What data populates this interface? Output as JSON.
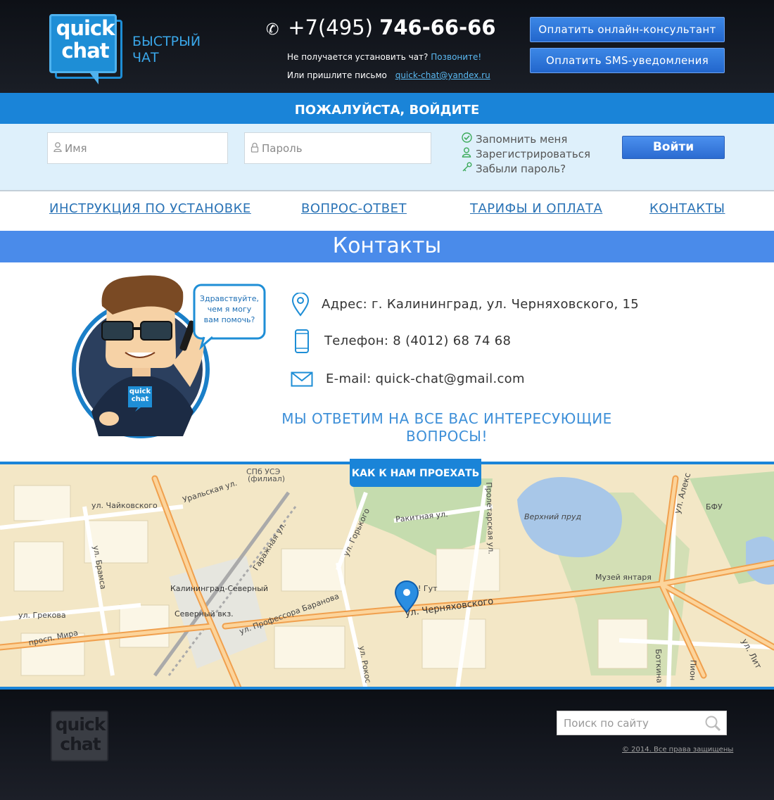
{
  "header": {
    "logo_text": "quick chat",
    "brand_line1": "БЫСТРЫЙ",
    "brand_line2": "ЧАТ",
    "phone_prefix": "+7(495)",
    "phone_number": "746-66-66",
    "line1_text": "Не получается установить чат?",
    "line1_link": "Позвоните!",
    "line2_text": "Или пришлите письмо",
    "line2_email": "quick-chat@yandex.ru",
    "btn_consultant": "Оплатить онлайн-консультант",
    "btn_sms": "Оплатить SMS-уведомления"
  },
  "login": {
    "title": "ПОЖАЛУЙСТА, ВОЙДИТЕ",
    "name_placeholder": "Имя",
    "password_placeholder": "Пароль",
    "remember": "Запомнить меня",
    "register": "Зарегистрироваться",
    "forgot": "Забыли пароль?",
    "submit": "Войти"
  },
  "nav": {
    "install": "ИНСТРУКЦИЯ ПО УСТАНОВКЕ",
    "faq": "ВОПРОС-ОТВЕТ",
    "pricing": "ТАРИФЫ И ОПЛАТА",
    "contacts": "КОНТАКТЫ"
  },
  "page": {
    "title": "Контакты"
  },
  "contacts": {
    "bubble_line1": "Здравствуйте,",
    "bubble_line2": "чем я могу",
    "bubble_line3": "вам помочь?",
    "shirt_logo": "quick chat",
    "address": "Адрес: г. Калининград, ул. Черняховского, 15",
    "phone": "Телефон: 8 (4012) 68 74 68",
    "email": "E-mail: quick-chat@gmail.com",
    "tagline_line1": "МЫ ОТВЕТИМ НА ВСЕ ВАС ИНТЕРЕСУЮЩИЕ",
    "tagline_line2": "ВОПРОСЫ!"
  },
  "map": {
    "tab_label": "КАК К НАМ ПРОЕХАТЬ",
    "labels": {
      "spb": "СПб УСЭ",
      "filial": "(филиал)",
      "uralskaya": "Уральская ул.",
      "chaikovskogo": "ул. Чайковского",
      "garazhnaya": "Гаражная ул.",
      "gorkogo": "ул. Горького",
      "rakitnaya": "Ракитная ул.",
      "proletarskaya": "Пролетарская ул.",
      "verkhny_prud": "Верхний пруд",
      "bfu": "БФУ",
      "aleksandra": "ул. Алекс",
      "bramsa": "ул. Брамса",
      "kaliningrad_sev": "Калининград-Северный",
      "sev_vokzal": "Северный вкз.",
      "grekova": "ул. Грекова",
      "baranova": "ул. Профессора Баранова",
      "chernyakhovskogo": "ул. Черняховского",
      "gut": "! Гут",
      "muzei": "Музей янтаря",
      "mira": "просп. Мира",
      "rokos": "ул. Рокос",
      "botkina": "Боткина",
      "pion": "Пион",
      "lit": "ул. Лит"
    }
  },
  "footer": {
    "logo_text": "quick chat",
    "search_placeholder": "Поиск по сайту",
    "copyright": "© 2014. Все права защищены"
  },
  "colors": {
    "header_bg": "#12151c",
    "primary_blue": "#1a84d8",
    "title_blue": "#4a8bea",
    "login_bg": "#def0fb",
    "nav_link": "#2a73b6"
  },
  "icons": {
    "phone": "phone-icon",
    "user": "user-icon",
    "lock": "lock-icon",
    "check": "check-icon",
    "register": "person-icon",
    "key": "key-icon",
    "location": "location-pin-icon",
    "mobile": "mobile-phone-icon",
    "mail": "envelope-icon",
    "search": "magnifier-icon"
  }
}
